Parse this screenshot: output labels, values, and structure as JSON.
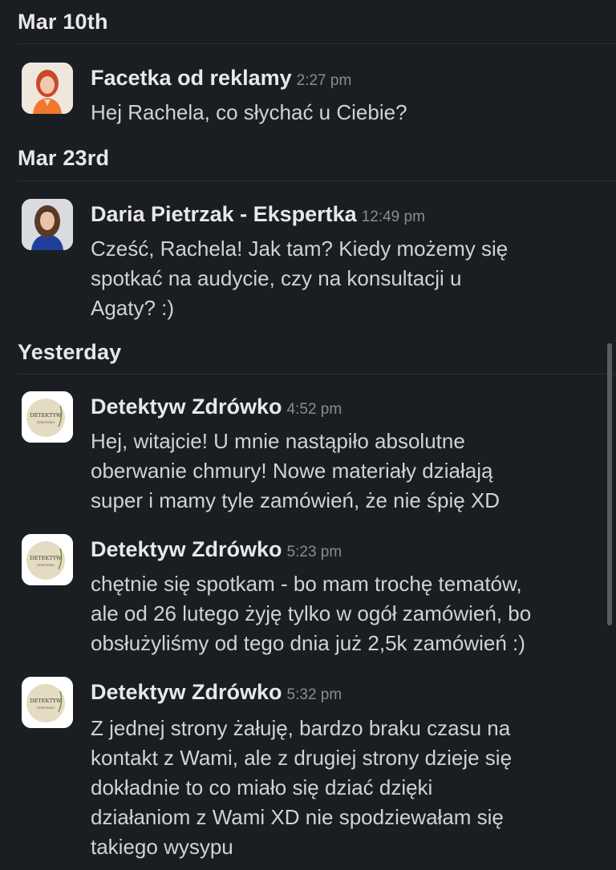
{
  "sections": [
    {
      "date": "Mar 10th",
      "messages": [
        {
          "sender": "Facetka od reklamy",
          "time": "2:27 pm",
          "lines": [
            "Hej Rachela, co słychać u Ciebie?"
          ]
        }
      ]
    },
    {
      "date": "Mar 23rd",
      "messages": [
        {
          "sender": "Daria Pietrzak - Ekspertka",
          "time": "12:49 pm",
          "lines": [
            "Cześć, Rachela! Jak tam? Kiedy możemy się",
            "spotkać na audycie, czy na konsultacji u",
            "Agaty? :)"
          ]
        }
      ]
    },
    {
      "date": "Yesterday",
      "messages": [
        {
          "sender": "Detektyw Zdrówko",
          "time": "4:52 pm",
          "lines": [
            "Hej, witajcie! U mnie nastąpiło absolutne",
            "oberwanie chmury! Nowe materiały działają",
            "super i mamy tyle zamówień, że nie śpię XD"
          ]
        },
        {
          "sender": "Detektyw Zdrówko",
          "time": "5:23 pm",
          "lines": [
            "chętnie się spotkam - bo mam trochę tematów,",
            "ale od 26 lutego żyję tylko w ogół zamówień, bo",
            "obsłużyliśmy od tego dnia już 2,5k zamówień :)"
          ]
        },
        {
          "sender": "Detektyw Zdrówko",
          "time": "5:32 pm",
          "lines": [
            "Z jednej strony żałuję, bardzo braku czasu na",
            "kontakt z Wami, ale z drugiej strony dzieje się",
            "dokładnie to co miało się dziać dzięki",
            "działaniom z Wami XD nie spodziewałam się",
            "takiego wysypu"
          ]
        }
      ]
    }
  ],
  "logo": {
    "brand_line1": "DETEKTYW",
    "brand_line2": "ZDRÓWKO"
  },
  "colors": {
    "background": "#1a1d21",
    "text": "#d1d2d3",
    "name": "#e8e8e8",
    "timestamp": "#8a8c8f",
    "divider": "#2c2f33",
    "logo_circle": "#e4dcc2"
  }
}
